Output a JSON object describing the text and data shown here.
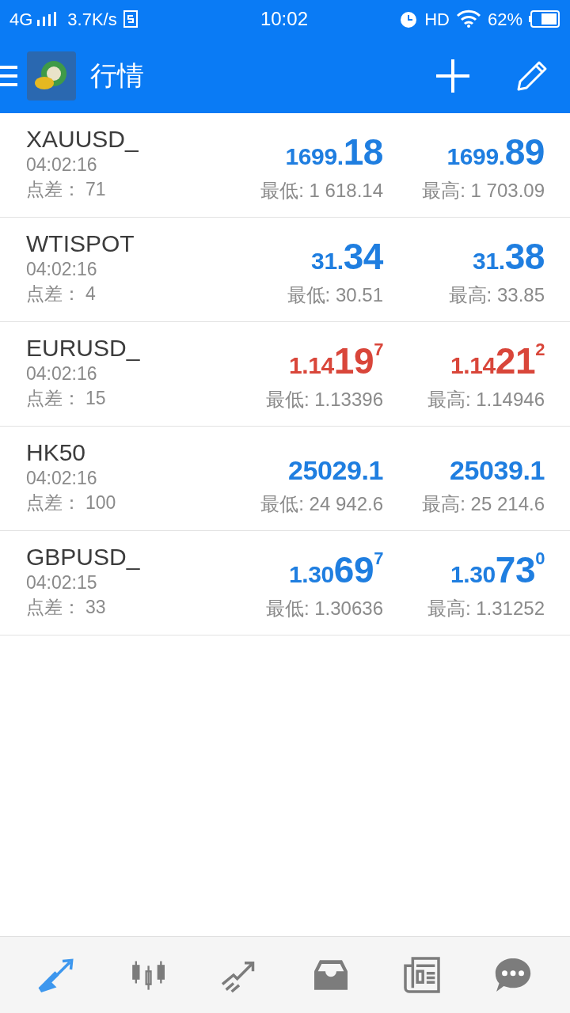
{
  "status_bar": {
    "network": "4G",
    "speed": "3.7K/s",
    "time": "10:02",
    "hd": "HD",
    "battery": "62%"
  },
  "header": {
    "title": "行情"
  },
  "quotes": [
    {
      "symbol": "XAUUSD_",
      "time": "04:02:16",
      "spread_label": "点差：",
      "spread": "71",
      "color": "#1f7ee0",
      "bid": {
        "prefix": "1699.",
        "big": "18"
      },
      "ask": {
        "prefix": "1699.",
        "big": "89"
      },
      "low": "最低: 1 618.14",
      "high": "最高: 1 703.09"
    },
    {
      "symbol": "WTISPOT",
      "time": "04:02:16",
      "spread_label": "点差：",
      "spread": "4",
      "color": "#1f7ee0",
      "bid": {
        "prefix": "31.",
        "big": "34"
      },
      "ask": {
        "prefix": "31.",
        "big": "38"
      },
      "low": "最低: 30.51",
      "high": "最高: 33.85"
    },
    {
      "symbol": "EURUSD_",
      "time": "04:02:16",
      "spread_label": "点差：",
      "spread": "15",
      "color": "#d9463a",
      "bid": {
        "prefix": "1.14",
        "big": "19",
        "sup": "7"
      },
      "ask": {
        "prefix": "1.14",
        "big": "21",
        "sup": "2"
      },
      "low": "最低: 1.13396",
      "high": "最高: 1.14946"
    },
    {
      "symbol": "HK50",
      "time": "04:02:16",
      "spread_label": "点差：",
      "spread": "100",
      "color": "#1f7ee0",
      "bid": {
        "prefix": "25029.1"
      },
      "ask": {
        "prefix": "25039.1"
      },
      "low": "最低: 24 942.6",
      "high": "最高: 25 214.6"
    },
    {
      "symbol": "GBPUSD_",
      "time": "04:02:15",
      "spread_label": "点差：",
      "spread": "33",
      "color": "#1f7ee0",
      "bid": {
        "prefix": "1.30",
        "big": "69",
        "sup": "7"
      },
      "ask": {
        "prefix": "1.30",
        "big": "73",
        "sup": "0"
      },
      "low": "最低: 1.30636",
      "high": "最高: 1.31252"
    }
  ],
  "nav": [
    {
      "kind": "quotes",
      "selected": true
    },
    {
      "kind": "chart",
      "selected": false
    },
    {
      "kind": "trade",
      "selected": false
    },
    {
      "kind": "inbox",
      "selected": false
    },
    {
      "kind": "news",
      "selected": false
    },
    {
      "kind": "chat",
      "selected": false
    }
  ]
}
